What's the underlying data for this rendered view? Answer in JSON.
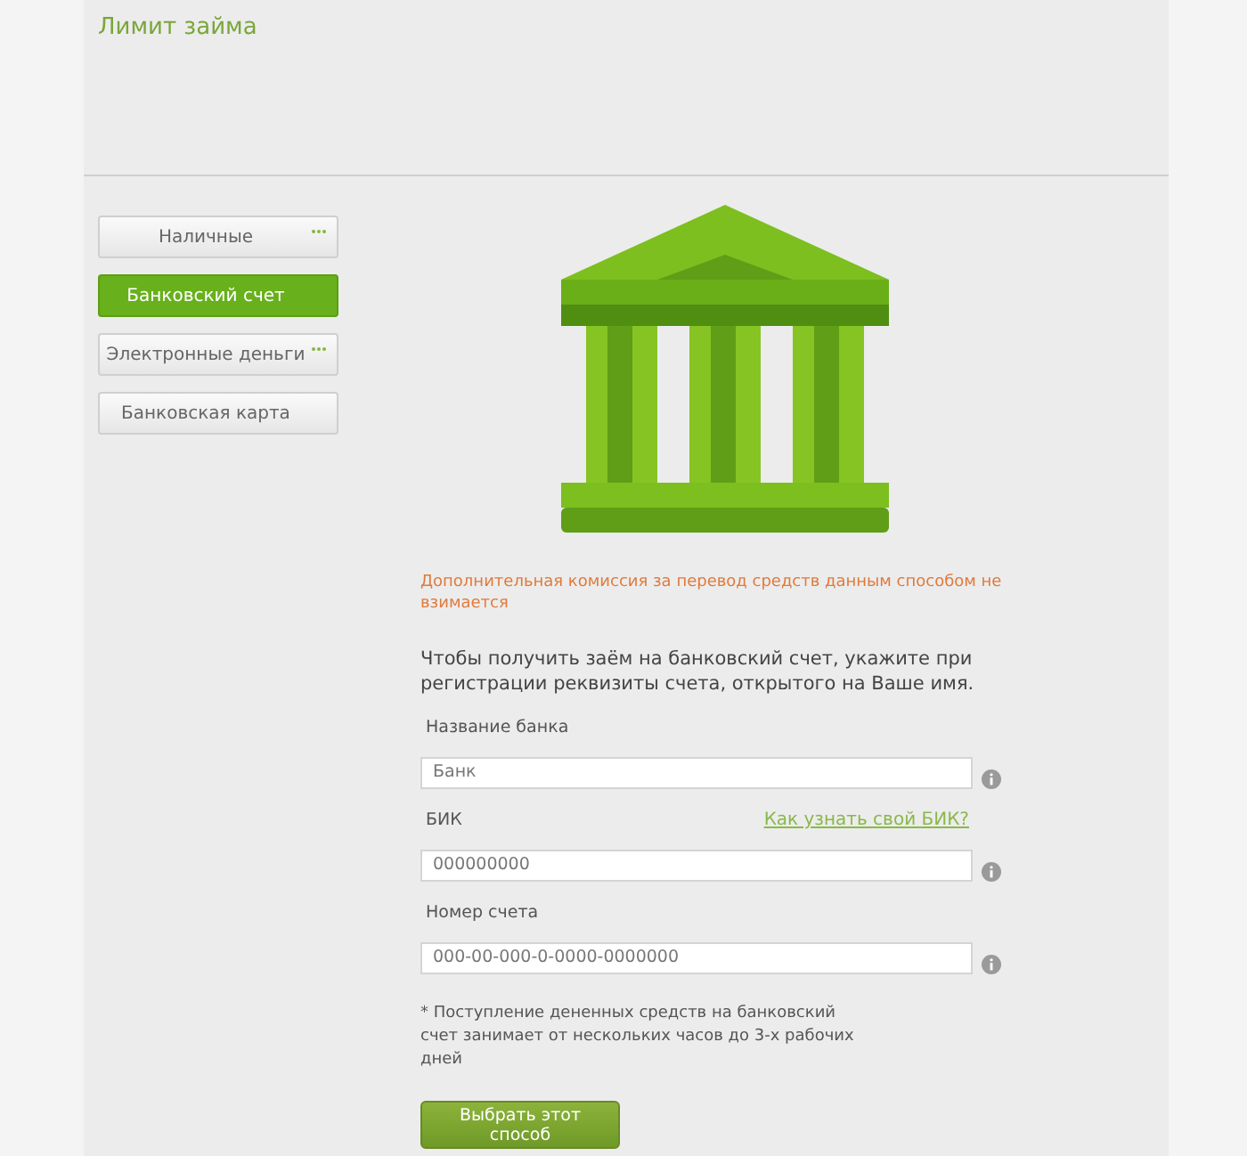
{
  "header": {
    "title": "Лимит займа"
  },
  "methods": [
    {
      "label": "Наличные",
      "selected": false,
      "has_more": true
    },
    {
      "label": "Банковский счет",
      "selected": true,
      "has_more": false
    },
    {
      "label": "Электронные деньги",
      "selected": false,
      "has_more": true
    },
    {
      "label": "Банковская карта",
      "selected": false,
      "has_more": false
    }
  ],
  "commission_note": "Дополнительная комиссия за перевод средств данным способом не взимается",
  "intro": "Чтобы получить заём на банковский счет, укажите при регистрации реквизиты счета, открытого на Ваше имя.",
  "fields": [
    {
      "label": "Название банка",
      "placeholder": "Банк"
    },
    {
      "label": "БИК",
      "placeholder": "000000000",
      "link": "Как узнать свой БИК?"
    },
    {
      "label": "Номер счета",
      "placeholder": "000-00-000-0-0000-0000000"
    }
  ],
  "footnote": "* Поступление дененных средств на банковский счет занимает от нескольких часов до 3-х рабочих дней",
  "submit": "Выбрать этот способ"
}
